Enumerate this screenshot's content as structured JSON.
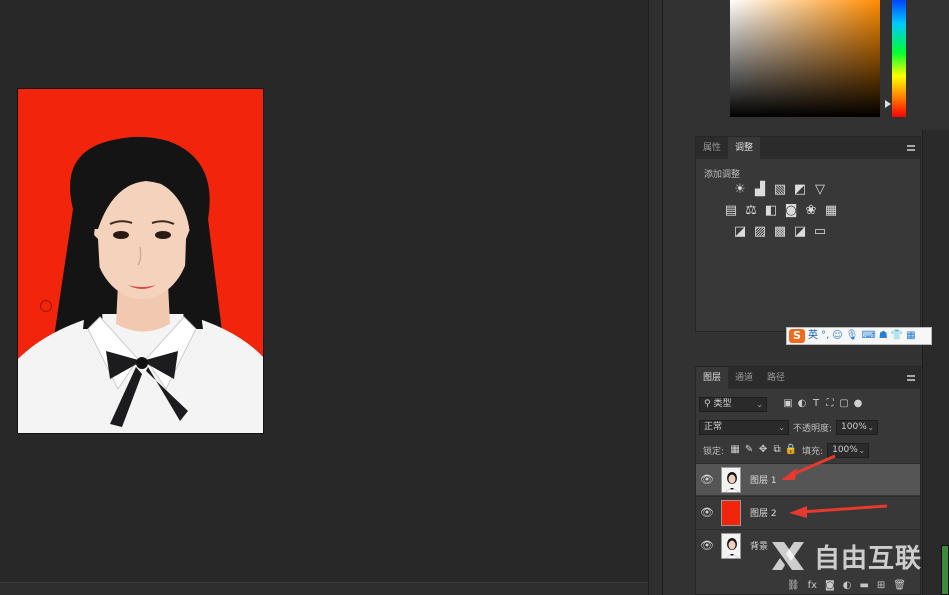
{
  "properties_panel": {
    "tabs": [
      "属性",
      "调整"
    ],
    "active_tab": "调整",
    "heading": "添加调整"
  },
  "layers_panel": {
    "tabs": [
      "图层",
      "通道",
      "路径"
    ],
    "active_tab": "图层",
    "filter_kind": "类型",
    "blend_mode": "正常",
    "opacity_label": "不透明度:",
    "opacity_value": "100%",
    "lock_label": "锁定:",
    "fill_label": "填充:",
    "fill_value": "100%",
    "layers": [
      {
        "name": "图层 1",
        "thumb": "portrait",
        "selected": true
      },
      {
        "name": "图层 2",
        "thumb": "red",
        "selected": false
      },
      {
        "name": "背景",
        "thumb": "portrait",
        "selected": false
      }
    ],
    "footer_fx": "fx"
  },
  "ime_toolbar": {
    "logo": "S",
    "mode": "英"
  },
  "watermark": {
    "text": "自由互联"
  },
  "colors": {
    "photo_background": "#f2240c",
    "arrow": "#e63a2e"
  }
}
